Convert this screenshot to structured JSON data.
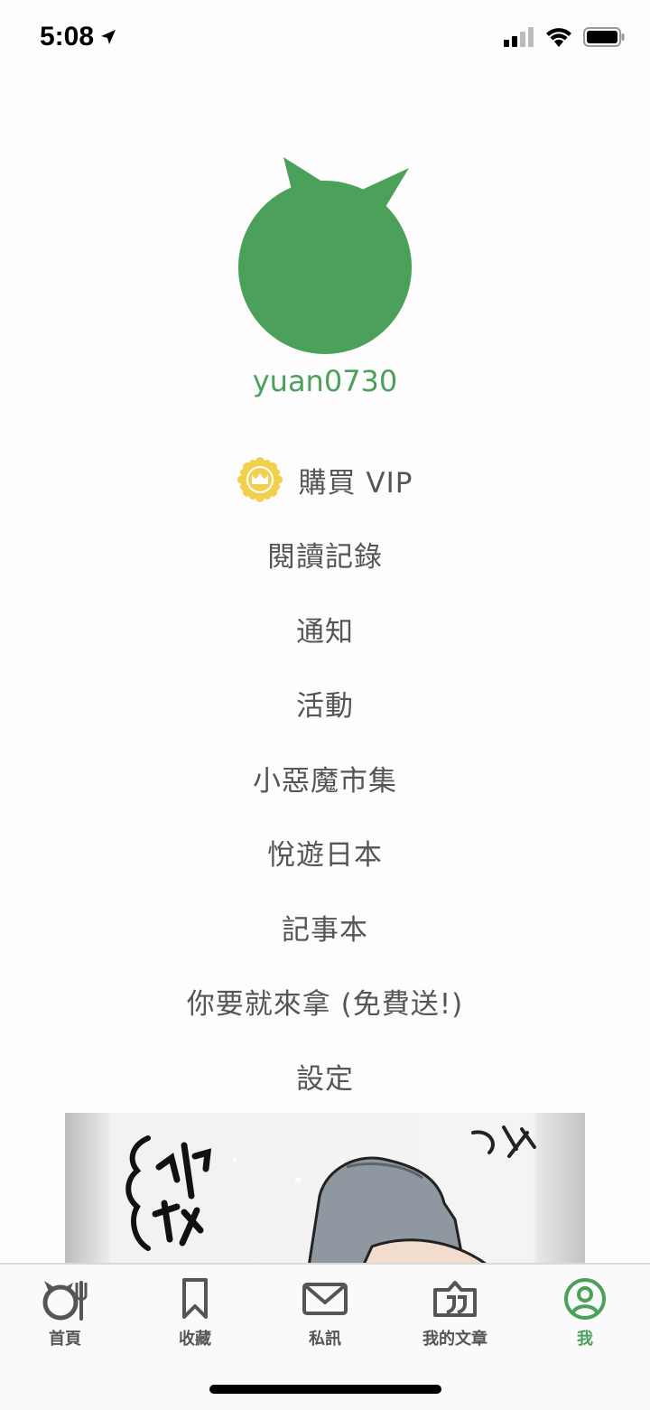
{
  "status_bar": {
    "time": "5:08"
  },
  "profile": {
    "username": "yuan0730",
    "accent_color": "#4ba15a"
  },
  "menu": {
    "items": [
      {
        "label": "購買 VIP",
        "icon": "crown-badge-icon"
      },
      {
        "label": "閱讀記錄"
      },
      {
        "label": "通知"
      },
      {
        "label": "活動"
      },
      {
        "label": "小惡魔市集"
      },
      {
        "label": "悅遊日本"
      },
      {
        "label": "記事本"
      },
      {
        "label": "你要就來拿 (免費送!)"
      },
      {
        "label": "設定"
      }
    ]
  },
  "banner": {
    "icon": "comic-ad-banner"
  },
  "tab_bar": {
    "tabs": [
      {
        "label": "首頁",
        "icon": "home-devil-icon"
      },
      {
        "label": "收藏",
        "icon": "bookmark-icon"
      },
      {
        "label": "私訊",
        "icon": "mail-icon"
      },
      {
        "label": "我的文章",
        "icon": "article-quote-icon"
      },
      {
        "label": "我",
        "icon": "profile-icon",
        "active": true
      }
    ]
  }
}
